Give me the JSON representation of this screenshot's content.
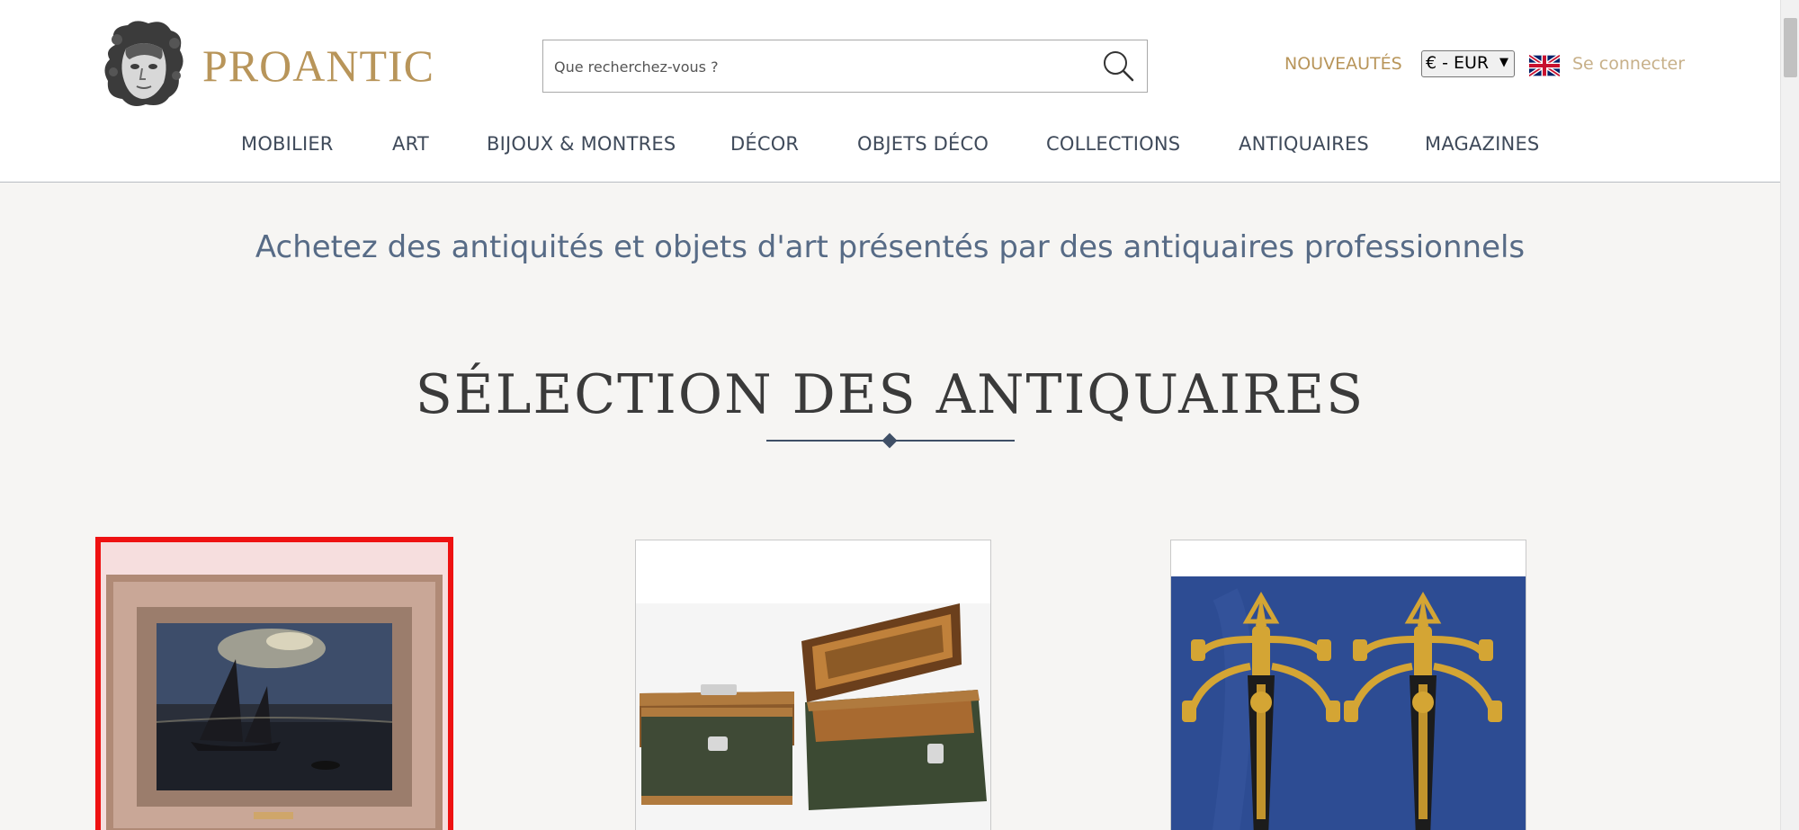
{
  "header": {
    "logo_text": "PROANTIC",
    "search": {
      "placeholder": "Que recherchez-vous ?",
      "value": ""
    },
    "nouveautes_label": "NOUVEAUTÉS",
    "currency": {
      "selected": "€ - EUR"
    },
    "language_icon": "uk-flag-icon",
    "login_label": "Se connecter"
  },
  "nav": {
    "items": [
      {
        "label": "MOBILIER"
      },
      {
        "label": "ART"
      },
      {
        "label": "BIJOUX & MONTRES"
      },
      {
        "label": "DÉCOR"
      },
      {
        "label": "OBJETS DÉCO"
      },
      {
        "label": "COLLECTIONS"
      },
      {
        "label": "ANTIQUAIRES"
      },
      {
        "label": "MAGAZINES"
      }
    ]
  },
  "main": {
    "tagline": "Achetez des antiquités et objets d'art présentés par des antiquaires professionnels",
    "section_title": "SÉLECTION DES ANTIQUAIRES",
    "products": [
      {
        "image": "framed-painting-boats-moonlight-image"
      },
      {
        "image": "two-wooden-boxes-image"
      },
      {
        "image": "gilt-bronze-candelabra-pair-image"
      }
    ]
  },
  "colors": {
    "brand_gold": "#b8955a",
    "nav_text": "#3f4a5a",
    "tagline_blue": "#576b86",
    "page_background": "#f6f5f3",
    "highlight_red": "#ee1111"
  }
}
